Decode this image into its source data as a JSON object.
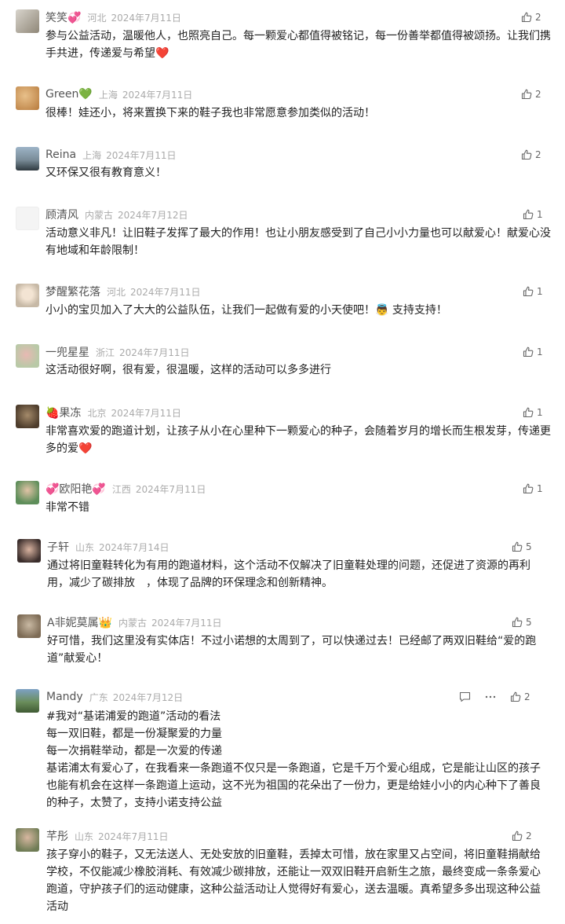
{
  "comments": [
    {
      "name": "笑笑💞",
      "location": "河北",
      "date": "2024年7月11日",
      "likes": "2",
      "text": "参与公益活动，温暖他人，也照亮自己。每一颗爱心都值得被铭记，每一份善举都值得被颂扬。让我们携手共进，传递爱与希望❤️"
    },
    {
      "name": "Green💚",
      "location": "上海",
      "date": "2024年7月11日",
      "likes": "2",
      "text": "很棒！娃还小，将来置换下来的鞋子我也非常愿意参加类似的活动！"
    },
    {
      "name": "Reina",
      "location": "上海",
      "date": "2024年7月11日",
      "likes": "2",
      "text": "又环保又很有教育意义！"
    },
    {
      "name": "顾清风",
      "location": "内蒙古",
      "date": "2024年7月12日",
      "likes": "1",
      "text": "活动意义非凡！让旧鞋子发挥了最大的作用！也让小朋友感受到了自己小小力量也可以献爱心！献爱心没有地域和年龄限制！"
    },
    {
      "name": "梦醒繁花落",
      "location": "河北",
      "date": "2024年7月11日",
      "likes": "1",
      "text": "小小的宝贝加入了大大的公益队伍，让我们一起做有爱的小天使吧！👼 支持支持！"
    },
    {
      "name": "一兜星星",
      "location": "浙江",
      "date": "2024年7月11日",
      "likes": "1",
      "text": "这活动很好啊，很有爱，很温暖，这样的活动可以多多进行"
    },
    {
      "name": "🍓果冻",
      "location": "北京",
      "date": "2024年7月11日",
      "likes": "1",
      "text": "非常喜欢爱的跑道计划，让孩子从小在心里种下一颗爱心的种子，会随着岁月的增长而生根发芽，传递更多的爱❤️"
    },
    {
      "name": "💞欧阳艳💞",
      "location": "江西",
      "date": "2024年7月11日",
      "likes": "1",
      "text": "非常不错"
    },
    {
      "name": "子轩",
      "location": "山东",
      "date": "2024年7月14日",
      "likes": "5",
      "text": "通过将旧童鞋转化为有用的跑道材料，这个活动不仅解决了旧童鞋处理的问题，还促进了资源的再利用，减少了碳排放　，体现了品牌的环保理念和创新精神。"
    },
    {
      "name": "A非妮莫属👑",
      "location": "内蒙古",
      "date": "2024年7月11日",
      "likes": "5",
      "text": "好可惜，我们这里没有实体店！不过小诺想的太周到了，可以快递过去！已经邮了两双旧鞋给“爱的跑道”献爱心！"
    },
    {
      "name": "Mandy",
      "location": "广东",
      "date": "2024年7月12日",
      "likes": "2",
      "text": "#我对“基诺浦爱的跑道”活动的看法\n每一双旧鞋，都是一份凝聚爱的力量\n每一次捐鞋举动，都是一次爱的传递\n基诺浦太有爱心了，在我看来一条跑道不仅只是一条跑道，它是千万个爱心组成，它是能让山区的孩子也能有机会在这样一条跑道上运动，这不光为祖国的花朵出了一份力，更是给娃小小的内心种下了善良的种子，太赞了，支持小诺支持公益"
    },
    {
      "name": "芊彤",
      "location": "山东",
      "date": "2024年7月11日",
      "likes": "2",
      "text": "孩子穿小的鞋子，又无法送人、无处安放的旧童鞋，丢掉太可惜，放在家里又占空间，将旧童鞋捐献给学校，不仅能减少橡胶消耗、有效减少碳排放，还能让一双双旧鞋开启新生之旅，最终变成一条条爱心跑道，守护孩子们的运动健康，这种公益活动让人觉得好有爱心，送去温暖。真希望多多出现这种公益活动"
    }
  ]
}
